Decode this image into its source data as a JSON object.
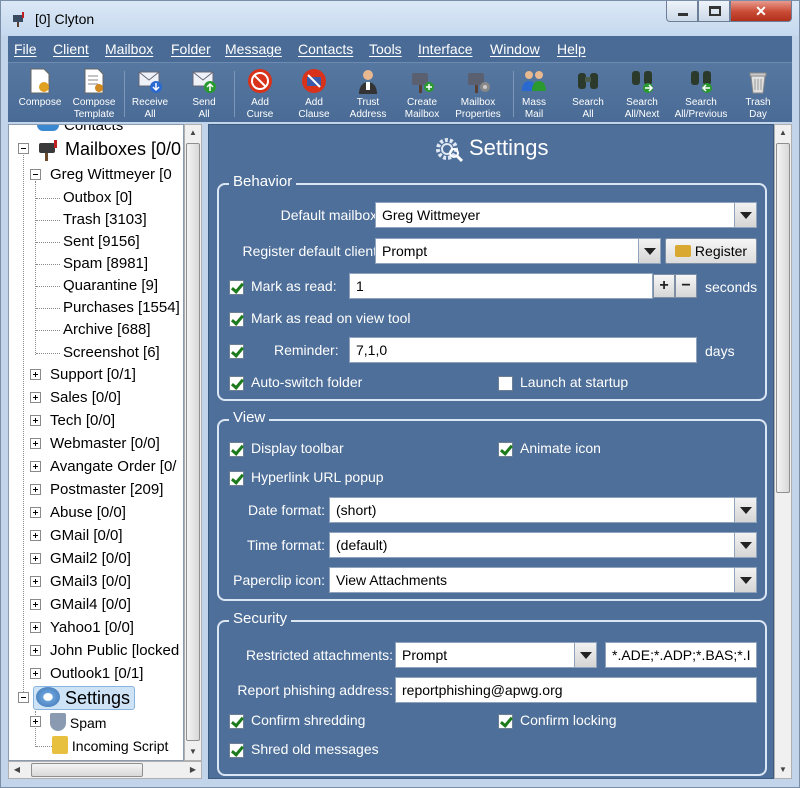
{
  "window": {
    "title": "[0] Clyton"
  },
  "menu": [
    "File",
    "Client",
    "Mailbox",
    "Folder",
    "Message",
    "Contacts",
    "Tools",
    "Interface",
    "Window",
    "Help"
  ],
  "toolbar": [
    {
      "line1": "Compose",
      "line2": "",
      "icon": "compose-icon"
    },
    {
      "line1": "Compose",
      "line2": "Template",
      "icon": "template-icon"
    },
    {
      "line1": "Receive",
      "line2": "All",
      "icon": "receive-icon"
    },
    {
      "line1": "Send",
      "line2": "All",
      "icon": "send-icon"
    },
    {
      "line1": "Add",
      "line2": "Curse",
      "icon": "curse-icon"
    },
    {
      "line1": "Add",
      "line2": "Clause",
      "icon": "clause-icon"
    },
    {
      "line1": "Trust",
      "line2": "Address",
      "icon": "trust-icon"
    },
    {
      "line1": "Create",
      "line2": "Mailbox",
      "icon": "create-mailbox-icon"
    },
    {
      "line1": "Mailbox",
      "line2": "Properties",
      "icon": "mailbox-properties-icon"
    },
    {
      "line1": "Mass",
      "line2": "Mail",
      "icon": "mass-mail-icon"
    },
    {
      "line1": "Search",
      "line2": "All",
      "icon": "binoculars-icon"
    },
    {
      "line1": "Search",
      "line2": "All/Next",
      "icon": "binoculars-next-icon"
    },
    {
      "line1": "Search",
      "line2": "All/Previous",
      "icon": "binoculars-prev-icon"
    },
    {
      "line1": "Trash",
      "line2": "Day",
      "icon": "trash-icon"
    }
  ],
  "tree": {
    "contacts": "Contacts",
    "mailboxes": "Mailboxes [0/0",
    "account": "Greg Wittmeyer [0",
    "folders": [
      "Outbox [0]",
      "Trash [3103]",
      "Sent [9156]",
      "Spam [8981]",
      "Quarantine [9]",
      "Purchases [1554]",
      "Archive [688]",
      "Screenshot [6]"
    ],
    "mailboxes_list": [
      "Support [0/1]",
      "Sales [0/0]",
      "Tech [0/0]",
      "Webmaster [0/0]",
      "Avangate Order [0/",
      "Postmaster [209]",
      "Abuse [0/0]",
      "GMail [0/0]",
      "GMail2 [0/0]",
      "GMail3 [0/0]",
      "GMail4 [0/0]",
      "Yahoo1 [0/0]",
      "John Public [locked",
      "Outlook1 [0/1]"
    ],
    "settings": "Settings",
    "settings_children": [
      "Spam",
      "Incoming Script"
    ]
  },
  "settings": {
    "heading": "Settings",
    "behavior": {
      "title": "Behavior",
      "default_mailbox_label": "Default mailbox:",
      "default_mailbox_value": "Greg Wittmeyer",
      "register_label": "Register default client:",
      "register_value": "Prompt",
      "register_button": "Register",
      "mark_read_label": "Mark as read:",
      "mark_read_value": "1",
      "mark_read_unit": "seconds",
      "mark_read_view_tool": "Mark as read on view tool",
      "reminder_label": "Reminder:",
      "reminder_value": "7,1,0",
      "reminder_unit": "days",
      "auto_switch": "Auto-switch folder",
      "launch_startup": "Launch at startup"
    },
    "view": {
      "title": "View",
      "display_toolbar": "Display toolbar",
      "animate_icon": "Animate icon",
      "hyperlink_popup": "Hyperlink URL popup",
      "date_format_label": "Date format:",
      "date_format_value": "(short)",
      "time_format_label": "Time format:",
      "time_format_value": "(default)",
      "paperclip_label": "Paperclip icon:",
      "paperclip_value": "View Attachments"
    },
    "security": {
      "title": "Security",
      "restricted_label": "Restricted attachments:",
      "restricted_value": "Prompt",
      "restricted_ext": "*.ADE;*.ADP;*.BAS;*.I",
      "phishing_label": "Report phishing address:",
      "phishing_value": "reportphishing@apwg.org",
      "confirm_shredding": "Confirm shredding",
      "confirm_locking": "Confirm locking",
      "shred_old": "Shred old messages"
    }
  }
}
